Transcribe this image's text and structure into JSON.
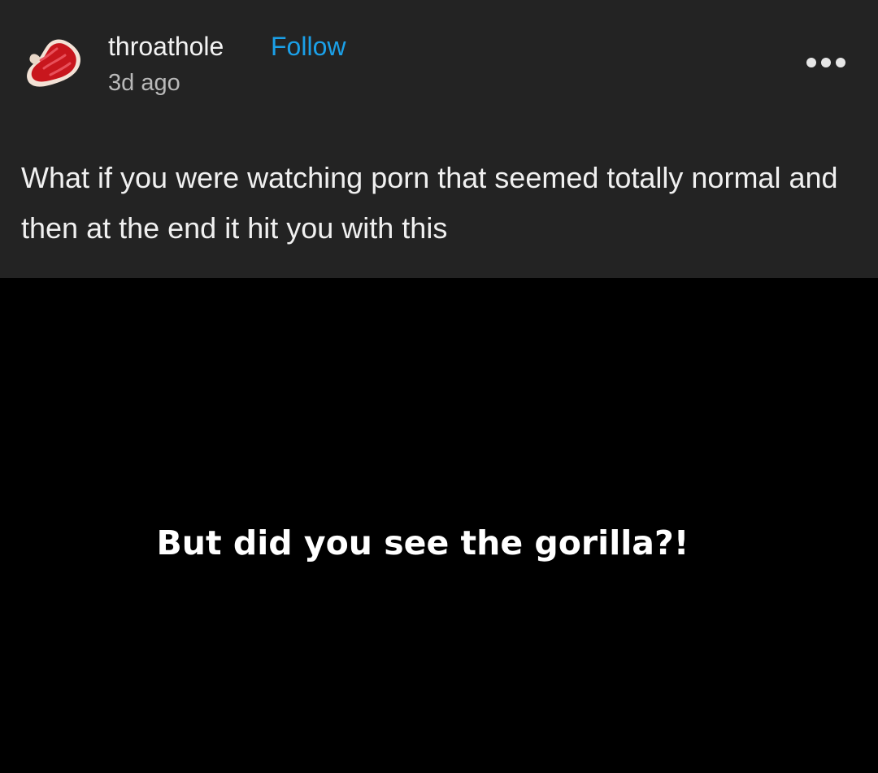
{
  "post": {
    "author": {
      "username": "throathole",
      "avatar_icon": "steak-icon"
    },
    "follow_label": "Follow",
    "timestamp": "3d ago",
    "more_icon": "more-options-icon",
    "text": "What if you were watching porn that seemed totally normal and then at the end it hit you with this",
    "media": {
      "caption": "But did you see the gorilla?!"
    }
  },
  "colors": {
    "header_background": "#232323",
    "media_background": "#000000",
    "follow_accent": "#1ba0e8",
    "text_primary": "#f0f0f0",
    "text_secondary": "#b9b9b9"
  }
}
